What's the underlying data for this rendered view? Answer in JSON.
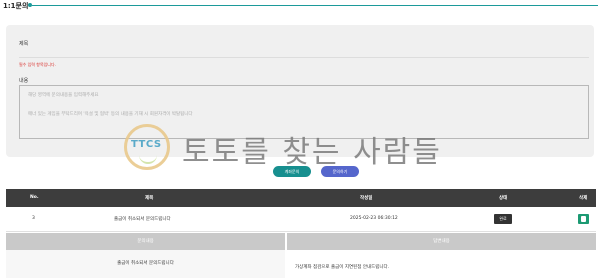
{
  "page": {
    "title": "1:1문의"
  },
  "form": {
    "subject_label": "제목",
    "required_msg": "필수 입력 항목입니다.",
    "content_label": "내용",
    "content_placeholder_line1": "해당 영역에 문의내용을 입력해주세요",
    "content_placeholder_line2": "매너 있는 게임을 부탁드리며 '욕설 및 협박' 등의 내용을 기재 시 회원자격이 박탈됩니다"
  },
  "watermark": {
    "logo_text": "TTCS",
    "text": "토토를 찾는 사람들"
  },
  "buttons": {
    "save_label": "계좌문의",
    "list_label": "문의하기"
  },
  "table": {
    "headers": [
      "No.",
      "제목",
      "작성일",
      "상태",
      "삭제"
    ],
    "rows": [
      {
        "no": "3",
        "title": "출금이 취소되서 문의드립니다",
        "date": "2025-02-23 06:30:12",
        "status": "완료"
      }
    ]
  },
  "detail": {
    "left_header": "문의내용",
    "right_header": "답변내용",
    "question": "출금이 취소되서 문의드립니다",
    "answer": "가상계좌 점검으로 출금이 지연된점 안내드립니다."
  },
  "colors": {
    "accent": "#1c9a9a",
    "save_button": "#178f8f",
    "list_button": "#5566cc",
    "table_header": "#3d3d3d",
    "required": "#d9302c"
  }
}
